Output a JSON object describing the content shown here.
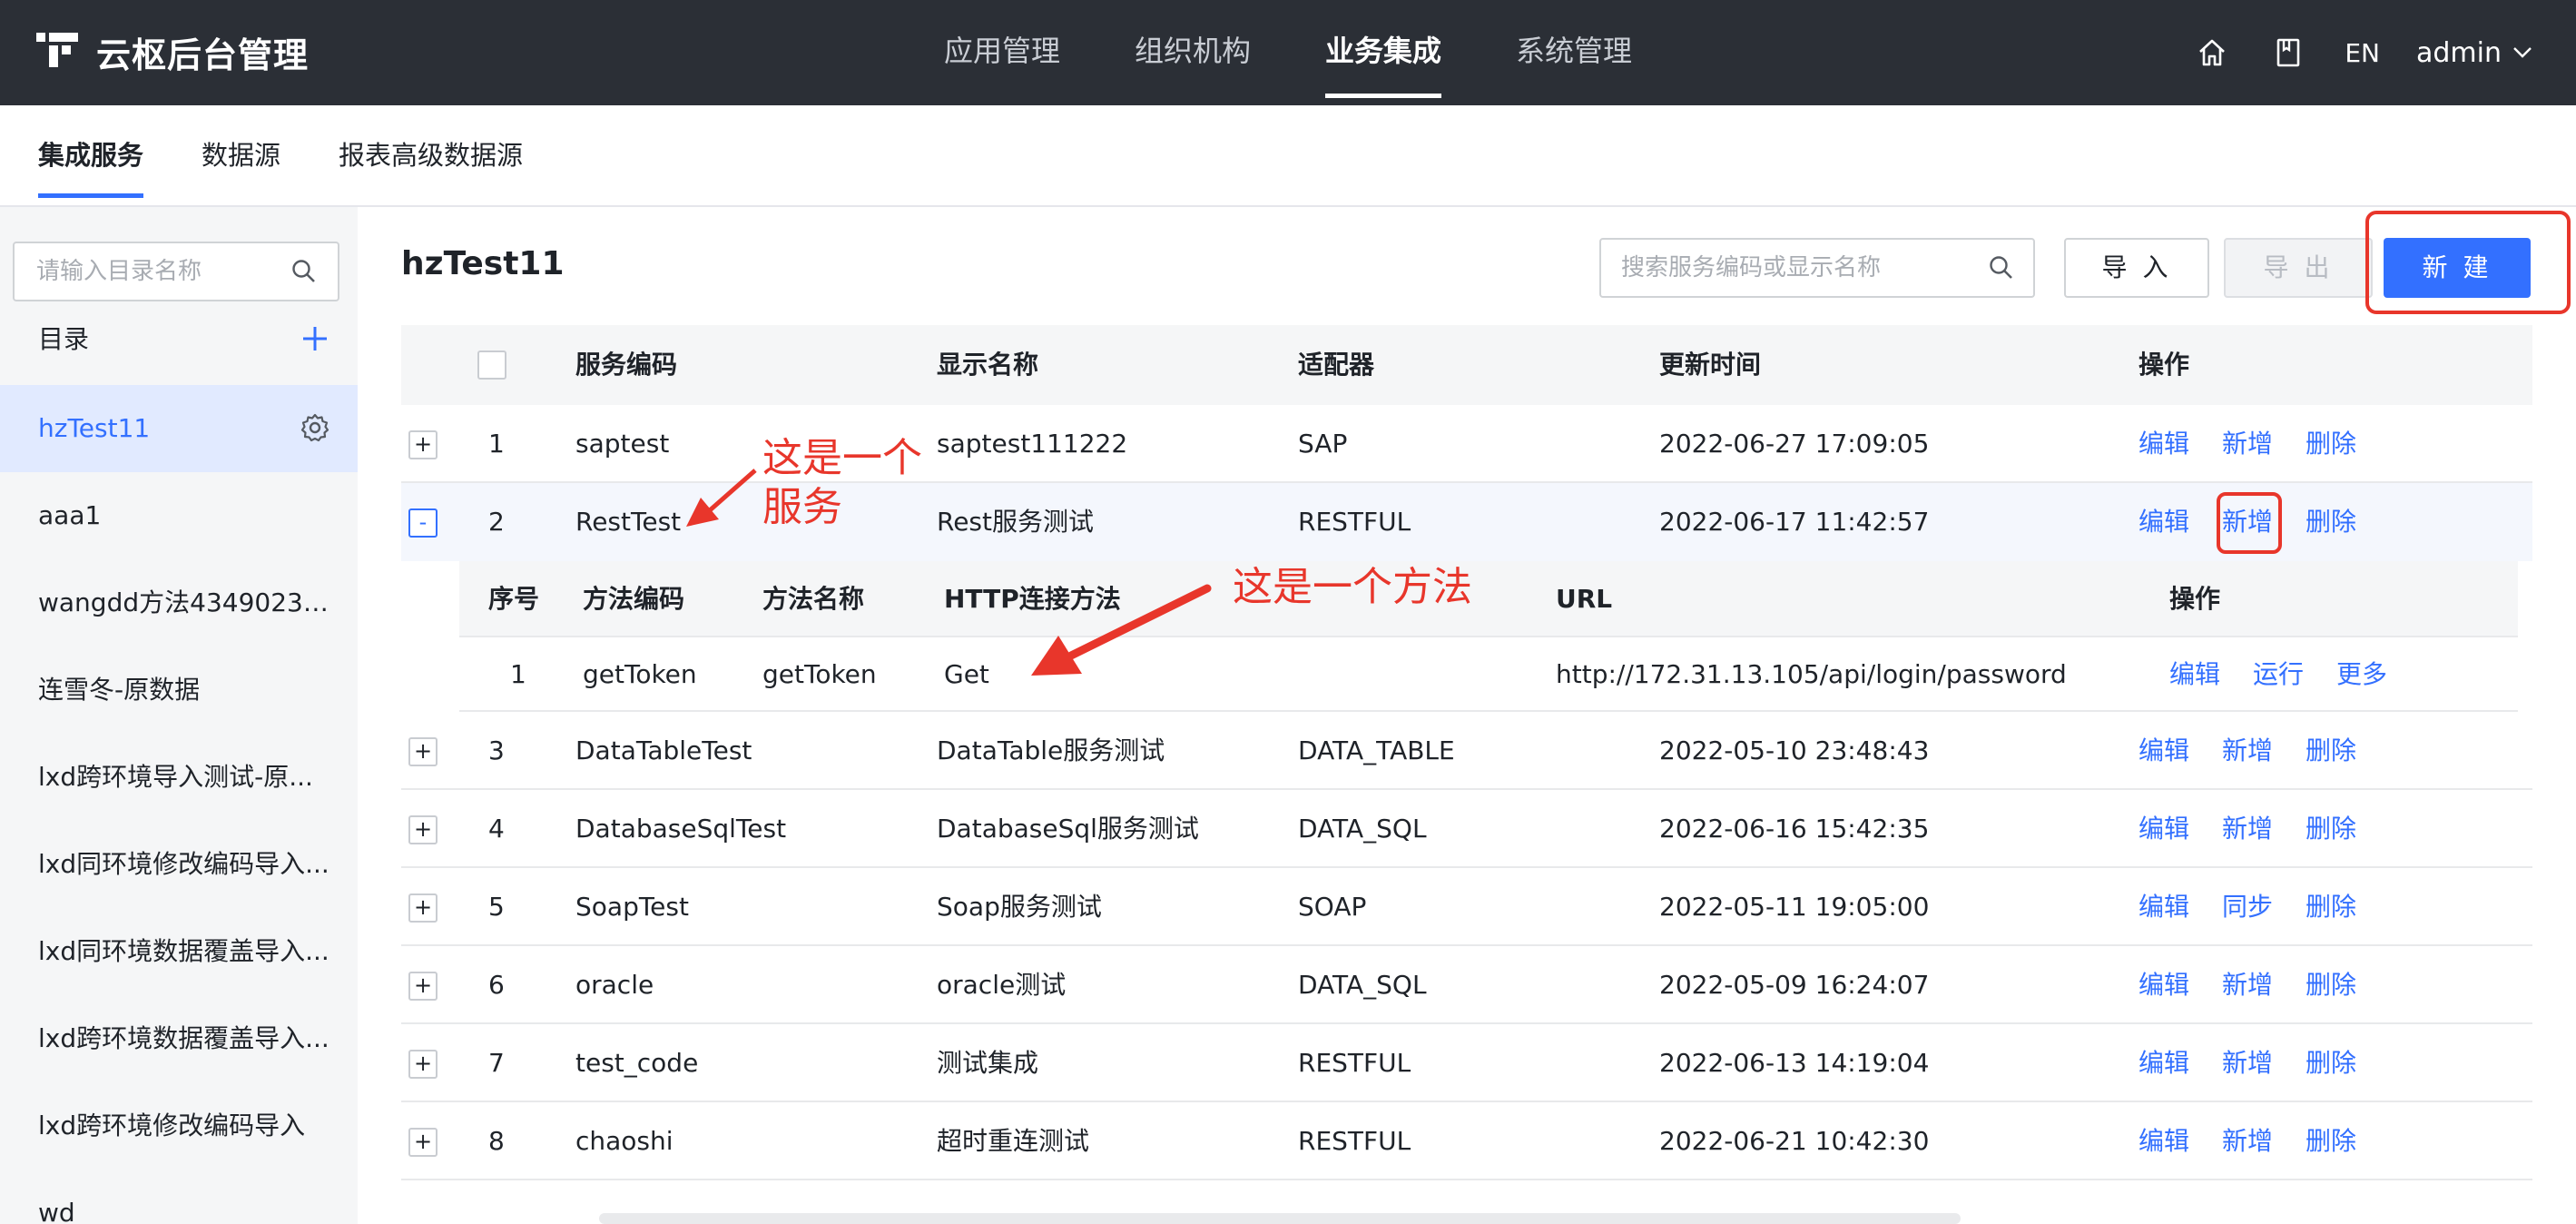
{
  "app": {
    "title": "云枢后台管理"
  },
  "topnav": [
    {
      "label": "应用管理",
      "active": false
    },
    {
      "label": "组织机构",
      "active": false
    },
    {
      "label": "业务集成",
      "active": true
    },
    {
      "label": "系统管理",
      "active": false
    }
  ],
  "topbar_right": {
    "lang": "EN",
    "user": "admin"
  },
  "subtabs": [
    {
      "label": "集成服务",
      "active": true
    },
    {
      "label": "数据源",
      "active": false
    },
    {
      "label": "报表高级数据源",
      "active": false
    }
  ],
  "sidebar": {
    "search_placeholder": "请输入目录名称",
    "dir_title": "目录",
    "items": [
      "hzTest11",
      "aaa1",
      "wangdd方法43490231...",
      "连雪冬-原数据",
      "lxd跨环境导入测试-原...",
      "lxd同环境修改编码导入...",
      "lxd同环境数据覆盖导入...",
      "lxd跨环境数据覆盖导入...",
      "lxd跨环境修改编码导入",
      "wd"
    ]
  },
  "main": {
    "title": "hzTest11",
    "search_placeholder": "搜索服务编码或显示名称",
    "btn_import": "导 入",
    "btn_export": "导 出",
    "btn_new": "新 建"
  },
  "table": {
    "headers": {
      "code": "服务编码",
      "name": "显示名称",
      "adapter": "适配器",
      "time": "更新时间",
      "ops": "操作"
    },
    "rows": [
      {
        "no": "1",
        "code": "saptest",
        "name": "saptest111222",
        "adapter": "SAP",
        "time": "2022-06-27 17:09:05",
        "ops": [
          "编辑",
          "新增",
          "删除"
        ]
      },
      {
        "no": "2",
        "code": "RestTest",
        "name": "Rest服务测试",
        "adapter": "RESTFUL",
        "time": "2022-06-17 11:42:57",
        "ops": [
          "编辑",
          "新增",
          "删除"
        ]
      },
      {
        "no": "3",
        "code": "DataTableTest",
        "name": "DataTable服务测试",
        "adapter": "DATA_TABLE",
        "time": "2022-05-10 23:48:43",
        "ops": [
          "编辑",
          "新增",
          "删除"
        ]
      },
      {
        "no": "4",
        "code": "DatabaseSqlTest",
        "name": "DatabaseSql服务测试",
        "adapter": "DATA_SQL",
        "time": "2022-06-16 15:42:35",
        "ops": [
          "编辑",
          "新增",
          "删除"
        ]
      },
      {
        "no": "5",
        "code": "SoapTest",
        "name": "Soap服务测试",
        "adapter": "SOAP",
        "time": "2022-05-11 19:05:00",
        "ops": [
          "编辑",
          "同步",
          "删除"
        ]
      },
      {
        "no": "6",
        "code": "oracle",
        "name": "oracle测试",
        "adapter": "DATA_SQL",
        "time": "2022-05-09 16:24:07",
        "ops": [
          "编辑",
          "新增",
          "删除"
        ]
      },
      {
        "no": "7",
        "code": "test_code",
        "name": "测试集成",
        "adapter": "RESTFUL",
        "time": "2022-06-13 14:19:04",
        "ops": [
          "编辑",
          "新增",
          "删除"
        ]
      },
      {
        "no": "8",
        "code": "chaoshi",
        "name": "超时重连测试",
        "adapter": "RESTFUL",
        "time": "2022-06-21 10:42:30",
        "ops": [
          "编辑",
          "新增",
          "删除"
        ]
      }
    ],
    "subtable": {
      "headers": {
        "no": "序号",
        "code": "方法编码",
        "name": "方法名称",
        "http": "HTTP连接方法",
        "url": "URL",
        "ops": "操作"
      },
      "rows": [
        {
          "no": "1",
          "code": "getToken",
          "name": "getToken",
          "http": "Get",
          "url": "http://172.31.13.105/api/login/password",
          "ops": [
            "编辑",
            "运行",
            "更多"
          ]
        }
      ]
    }
  },
  "annotations": {
    "service_line1": "这是一个",
    "service_line2": "服务",
    "method": "这是一个方法"
  },
  "colors": {
    "topbar": "#2b2f36",
    "accent": "#3370ff",
    "annotation": "#e8362b"
  }
}
